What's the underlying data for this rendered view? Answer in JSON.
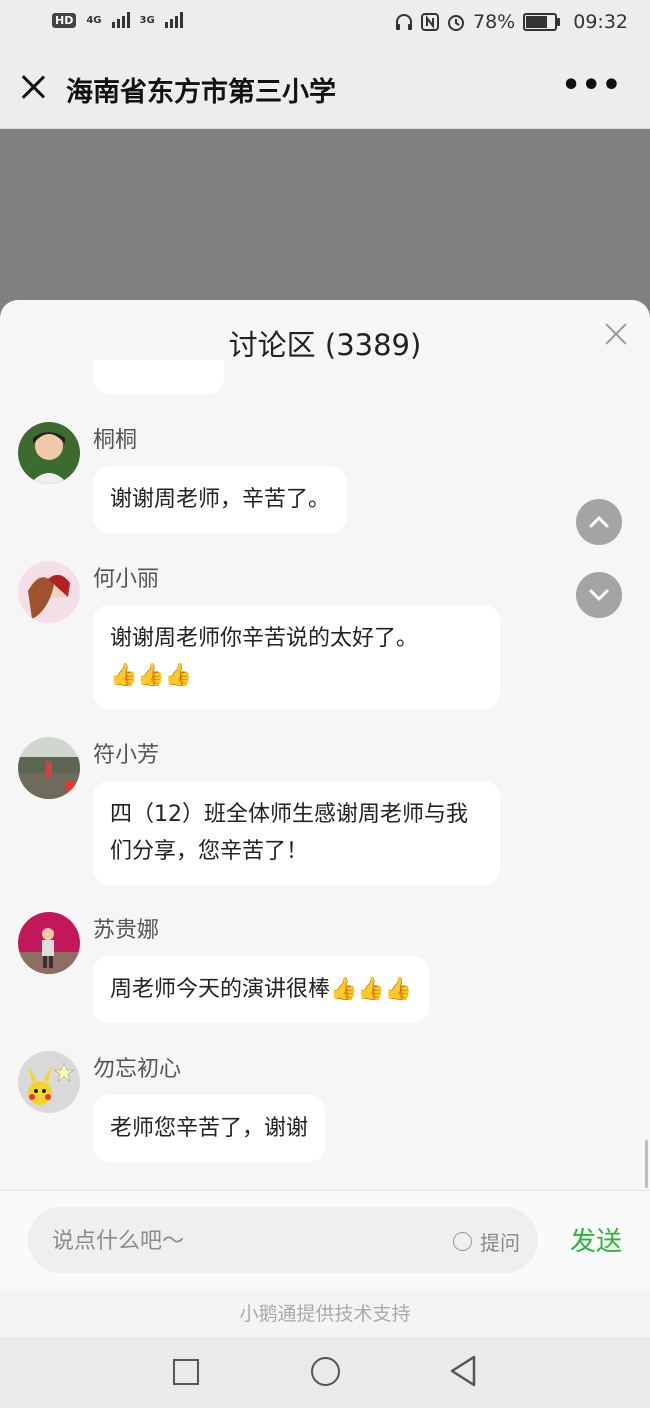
{
  "status_bar": {
    "hd": "HD",
    "net1": "4G",
    "net2": "3G",
    "battery_text": "78%",
    "battery_level": 0.78,
    "time": "09:32"
  },
  "header": {
    "title": "海南省东方市第三小学"
  },
  "discussion": {
    "title": "讨论区 (3389)"
  },
  "messages": [
    {
      "name": "桐桐",
      "text": "谢谢周老师，辛苦了。",
      "avatar": "photo-girl"
    },
    {
      "name": "何小丽",
      "text": "谢谢周老师你辛苦说的太好了。",
      "thumbs": "👍👍👍",
      "avatar": "anime-couple"
    },
    {
      "name": "符小芳",
      "text": "四（12）班全体师生感谢周老师与我们分享，您辛苦了！",
      "avatar": "landscape-photo"
    },
    {
      "name": "苏贵娜",
      "text": "周老师今天的演讲很棒",
      "thumbs": "👍👍👍",
      "avatar": "pink-stage"
    },
    {
      "name": "勿忘初心",
      "text": "老师您辛苦了，谢谢",
      "avatar": "pikachu"
    }
  ],
  "input": {
    "placeholder": "说点什么吧～",
    "ask_label": "提问",
    "send_label": "发送"
  },
  "footer": {
    "text": "小鹅通提供技术支持"
  },
  "colors": {
    "send": "#2eb33a",
    "overlay": "#808080"
  }
}
